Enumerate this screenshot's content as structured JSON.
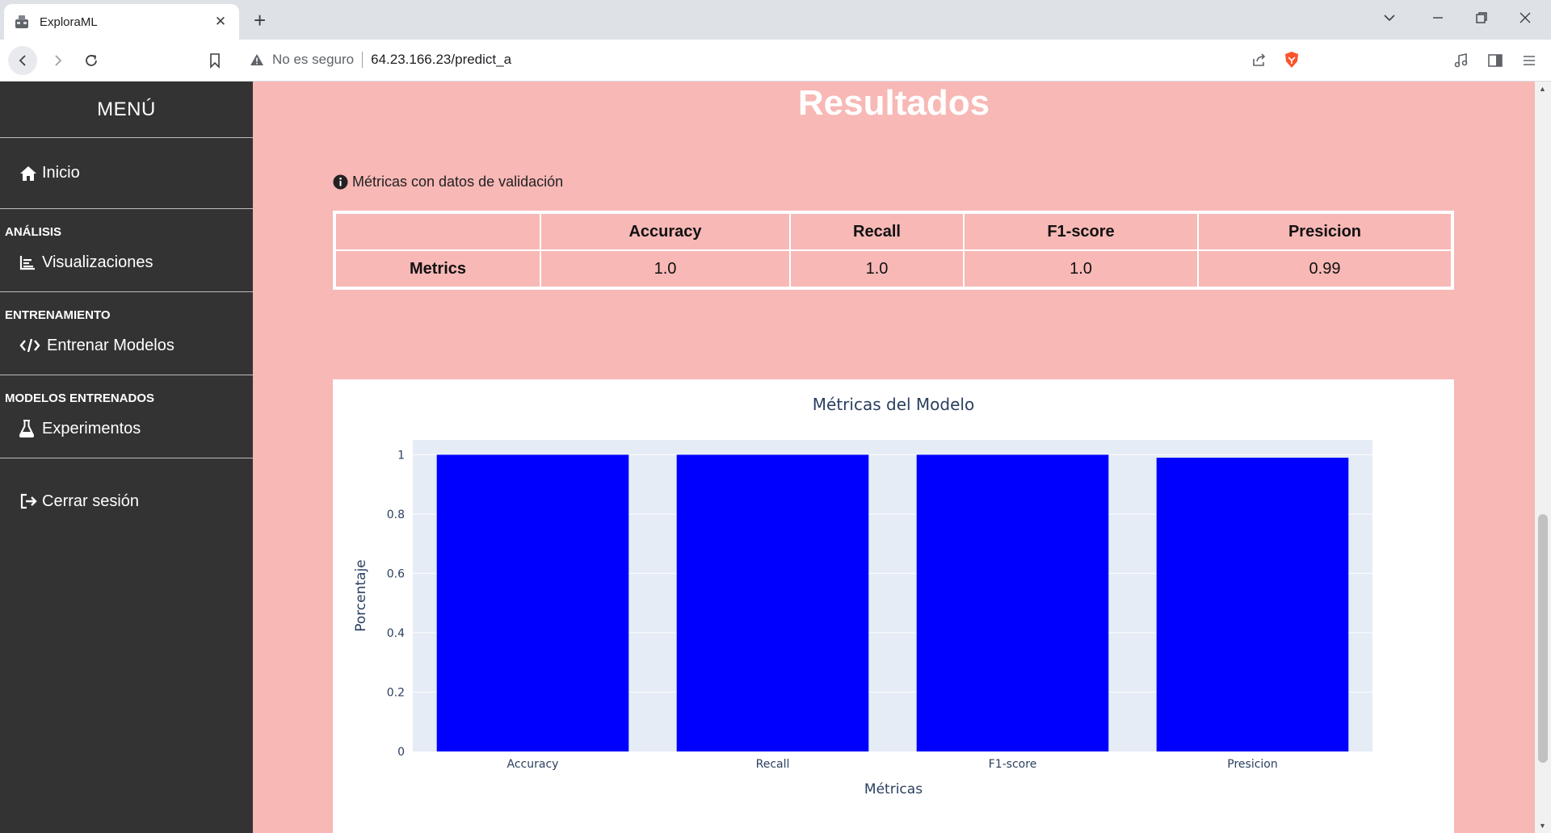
{
  "browser": {
    "tab_title": "ExploraML",
    "security_label": "No es seguro",
    "url": "64.23.166.23/predict_a"
  },
  "sidebar": {
    "menu_title": "MENÚ",
    "home_label": "Inicio",
    "analysis_header": "ANÁLISIS",
    "visualizations_label": "Visualizaciones",
    "training_header": "ENTRENAMIENTO",
    "train_models_label": "Entrenar Modelos",
    "trained_header": "MODELOS ENTRENADOS",
    "experiments_label": "Experimentos",
    "logout_label": "Cerrar sesión"
  },
  "main": {
    "title": "Resultados",
    "info_text": "Métricas con datos de validación",
    "table": {
      "headers": [
        "",
        "Accuracy",
        "Recall",
        "F1-score",
        "Presicion"
      ],
      "row_label": "Metrics",
      "values": [
        "1.0",
        "1.0",
        "1.0",
        "0.99"
      ]
    }
  },
  "colors": {
    "sidebar_bg": "#333333",
    "main_bg": "#f7b8b6",
    "bar_color": "#0000ff",
    "plot_bg": "#e5ecf6"
  },
  "chart_data": {
    "type": "bar",
    "title": "Métricas del Modelo",
    "xlabel": "Métricas",
    "ylabel": "Porcentaje",
    "categories": [
      "Accuracy",
      "Recall",
      "F1-score",
      "Presicion"
    ],
    "values": [
      1.0,
      1.0,
      1.0,
      0.99
    ],
    "ylim": [
      0,
      1.05
    ],
    "yticks": [
      0,
      0.2,
      0.4,
      0.6,
      0.8,
      1
    ],
    "ytick_labels": [
      "0",
      "0.2",
      "0.4",
      "0.6",
      "0.8",
      "1"
    ],
    "grid": true,
    "legend": "none"
  }
}
